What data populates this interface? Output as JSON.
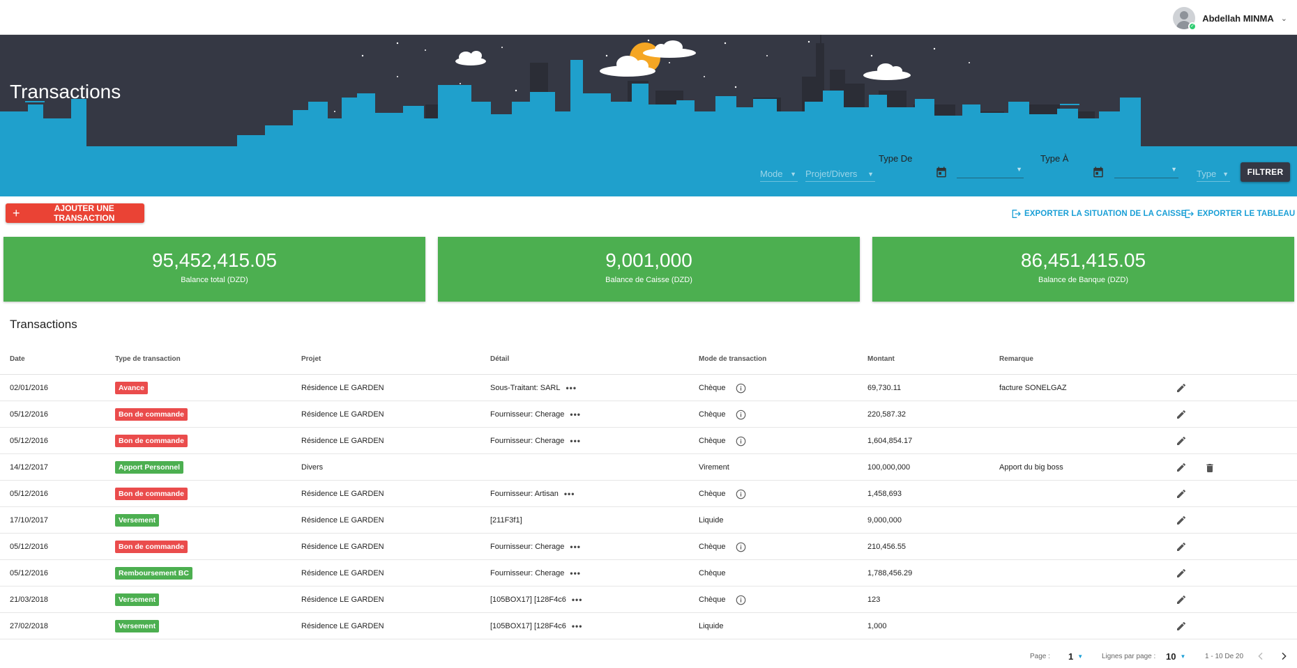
{
  "user": {
    "name": "Abdellah MINMA",
    "icon": "user-avatar-icon",
    "status_icon": "check-icon"
  },
  "page": {
    "title": "Transactions"
  },
  "filters": {
    "mode_placeholder": "Mode",
    "projet_placeholder": "Projet/Divers",
    "date_from_label": "Type De",
    "date_to_label": "Type À",
    "type_placeholder": "Type",
    "filter_button": "FILTRER"
  },
  "actions": {
    "add_transaction": "AJOUTER UNE TRANSACTION",
    "export_caisse": "EXPORTER LA SITUATION DE LA CAISSE",
    "export_table": "EXPORTER LE TABLEAU"
  },
  "balances": [
    {
      "value": "95,452,415.05",
      "label": "Balance total (DZD)"
    },
    {
      "value": "9,001,000",
      "label": "Balance de Caisse (DZD)"
    },
    {
      "value": "86,451,415.05",
      "label": "Balance de Banque (DZD)"
    }
  ],
  "table": {
    "title": "Transactions",
    "columns": [
      "Date",
      "Type de transaction",
      "Projet",
      "Détail",
      "Mode de transaction",
      "Montant",
      "Remarque"
    ],
    "rows": [
      {
        "date": "02/01/2016",
        "type": "Avance",
        "type_color": "#ea4c4c",
        "projet": "Résidence LE GARDEN",
        "detail": "Sous-Traitant: SARL",
        "detail_more": "•••",
        "mode": "Chèque",
        "mode_info": true,
        "montant": "69,730.11",
        "remarque": "facture SONELGAZ",
        "delete": false
      },
      {
        "date": "05/12/2016",
        "type": "Bon de commande",
        "type_color": "#ea4c4c",
        "projet": "Résidence LE GARDEN",
        "detail": "Fournisseur: Cherage",
        "detail_more": "•••",
        "mode": "Chèque",
        "mode_info": true,
        "montant": "220,587.32",
        "remarque": "",
        "delete": false
      },
      {
        "date": "05/12/2016",
        "type": "Bon de commande",
        "type_color": "#ea4c4c",
        "projet": "Résidence LE GARDEN",
        "detail": "Fournisseur: Cherage",
        "detail_more": "•••",
        "mode": "Chèque",
        "mode_info": true,
        "montant": "1,604,854.17",
        "remarque": "",
        "delete": false
      },
      {
        "date": "14/12/2017",
        "type": "Apport Personnel",
        "type_color": "#4caf50",
        "projet": "Divers",
        "detail": "",
        "detail_more": "",
        "mode": "Virement",
        "mode_info": false,
        "montant": "100,000,000",
        "remarque": "Apport du big boss",
        "delete": true
      },
      {
        "date": "05/12/2016",
        "type": "Bon de commande",
        "type_color": "#ea4c4c",
        "projet": "Résidence LE GARDEN",
        "detail": "Fournisseur: Artisan",
        "detail_more": "•••",
        "mode": "Chèque",
        "mode_info": true,
        "montant": "1,458,693",
        "remarque": "",
        "delete": false
      },
      {
        "date": "17/10/2017",
        "type": "Versement",
        "type_color": "#4caf50",
        "projet": "Résidence LE GARDEN",
        "detail": "[211F3f1]",
        "detail_more": "",
        "mode": "Liquide",
        "mode_info": false,
        "montant": "9,000,000",
        "remarque": "",
        "delete": false
      },
      {
        "date": "05/12/2016",
        "type": "Bon de commande",
        "type_color": "#ea4c4c",
        "projet": "Résidence LE GARDEN",
        "detail": "Fournisseur: Cherage",
        "detail_more": "•••",
        "mode": "Chèque",
        "mode_info": true,
        "montant": "210,456.55",
        "remarque": "",
        "delete": false
      },
      {
        "date": "05/12/2016",
        "type": "Remboursement BC",
        "type_color": "#4caf50",
        "projet": "Résidence LE GARDEN",
        "detail": "Fournisseur: Cherage",
        "detail_more": "•••",
        "mode": "Chèque",
        "mode_info": false,
        "montant": "1,788,456.29",
        "remarque": "",
        "delete": false
      },
      {
        "date": "21/03/2018",
        "type": "Versement",
        "type_color": "#4caf50",
        "projet": "Résidence LE GARDEN",
        "detail": "[105BOX17] [128F4c6",
        "detail_more": "•••",
        "mode": "Chèque",
        "mode_info": true,
        "montant": "123",
        "remarque": "",
        "delete": false
      },
      {
        "date": "27/02/2018",
        "type": "Versement",
        "type_color": "#4caf50",
        "projet": "Résidence LE GARDEN",
        "detail": "[105BOX17] [128F4c6",
        "detail_more": "•••",
        "mode": "Liquide",
        "mode_info": false,
        "montant": "1,000",
        "remarque": "",
        "delete": false
      }
    ]
  },
  "pagination": {
    "page_label": "Page :",
    "page_value": "1",
    "rows_label": "Lignes par page :",
    "rows_value": "10",
    "range": "1 - 10 De 20"
  },
  "colors": {
    "accent": "#1a9fd6",
    "danger": "#ea4335",
    "success": "#4caf50",
    "dark": "#353844",
    "sky_blue": "#1fa0cc"
  }
}
